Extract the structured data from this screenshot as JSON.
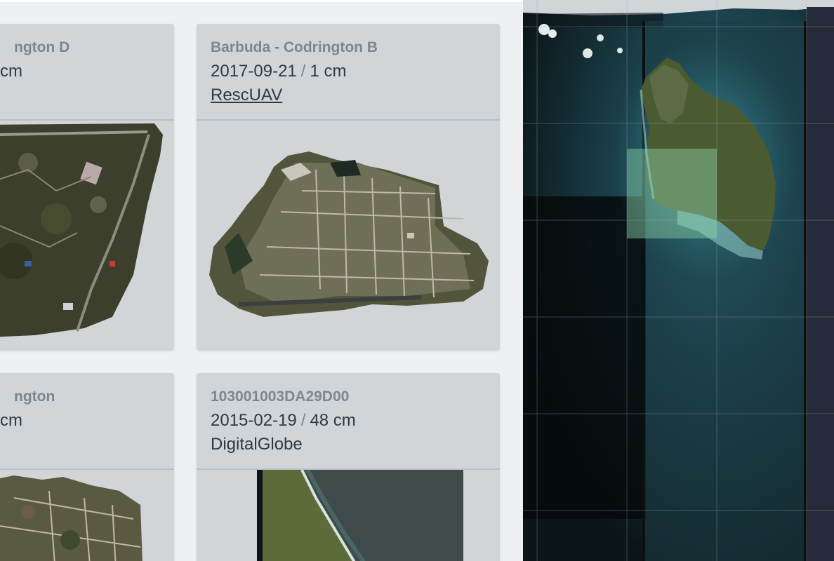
{
  "results": [
    {
      "title": "ngton D",
      "date": "",
      "resolution": "cm",
      "provider": "",
      "provider_is_link": false
    },
    {
      "title": "Barbuda - Codrington B",
      "date": "2017-09-21",
      "resolution": "1 cm",
      "provider": "RescUAV",
      "provider_is_link": true
    },
    {
      "title": "ngton",
      "date": "",
      "resolution": "cm",
      "provider": "",
      "provider_is_link": false
    },
    {
      "title": "103001003DA29D00",
      "date": "2015-02-19",
      "resolution": "48 cm",
      "provider": "DigitalGlobe",
      "provider_is_link": false
    }
  ],
  "meta_separator": "/",
  "map": {
    "highlight_color": "#8fd3a8"
  }
}
